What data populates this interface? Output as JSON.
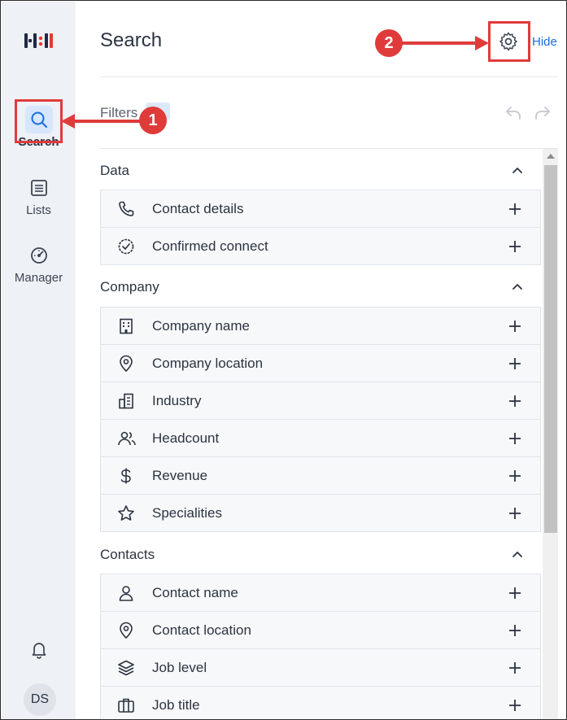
{
  "sidebar": {
    "nav": [
      {
        "label": "Search",
        "icon": "search-icon"
      },
      {
        "label": "Lists",
        "icon": "list-icon"
      },
      {
        "label": "Manager",
        "icon": "gauge-icon"
      }
    ],
    "avatar_initials": "DS"
  },
  "header": {
    "title": "Search",
    "hide_label": "Hide"
  },
  "filters": {
    "label": "Filters"
  },
  "sections": [
    {
      "title": "Data",
      "items": [
        {
          "label": "Contact details",
          "icon": "phone-icon"
        },
        {
          "label": "Confirmed connect",
          "icon": "check-badge-icon"
        }
      ]
    },
    {
      "title": "Company",
      "items": [
        {
          "label": "Company name",
          "icon": "building-icon"
        },
        {
          "label": "Company location",
          "icon": "location-pin-icon"
        },
        {
          "label": "Industry",
          "icon": "industry-icon"
        },
        {
          "label": "Headcount",
          "icon": "users-icon"
        },
        {
          "label": "Revenue",
          "icon": "dollar-icon"
        },
        {
          "label": "Specialities",
          "icon": "star-icon"
        }
      ]
    },
    {
      "title": "Contacts",
      "items": [
        {
          "label": "Contact name",
          "icon": "person-icon"
        },
        {
          "label": "Contact location",
          "icon": "location-pin-icon"
        },
        {
          "label": "Job level",
          "icon": "layers-icon"
        },
        {
          "label": "Job title",
          "icon": "briefcase-icon"
        }
      ]
    }
  ],
  "annotations": [
    {
      "number": "1"
    },
    {
      "number": "2"
    }
  ],
  "colors": {
    "accent": "#1a6ce0",
    "annotation": "#e03b3b",
    "sidebar_bg": "#eef1f5",
    "row_bg": "#f7f8fa"
  }
}
